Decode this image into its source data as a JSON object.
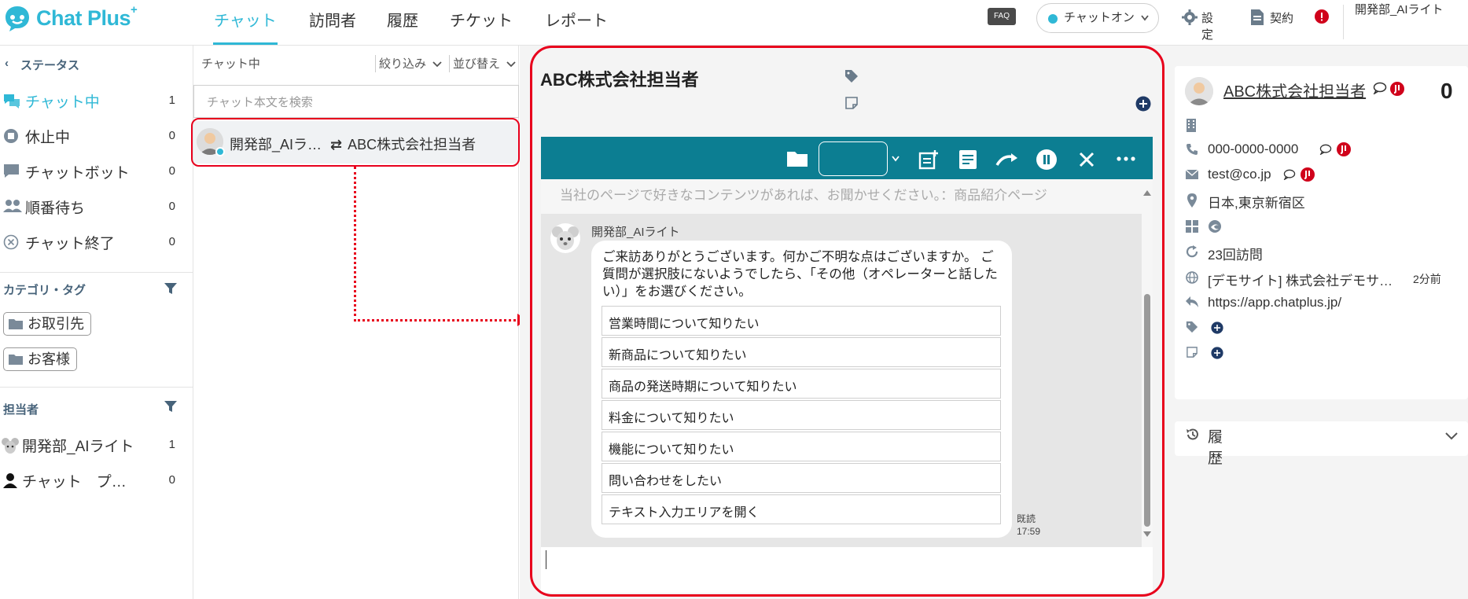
{
  "header": {
    "logo": "Chat Plus",
    "logo_sup": "+",
    "nav": [
      "チャット",
      "訪問者",
      "履歴",
      "チケット",
      "レポート"
    ],
    "faq": "FAQ",
    "chat_status": "チャットオン",
    "settings": "設定",
    "contract": "契約",
    "user": "開発部_AIライト"
  },
  "sidebar": {
    "status_head": "ステータス",
    "items": [
      {
        "label": "チャット中",
        "count": "1"
      },
      {
        "label": "休止中",
        "count": "0"
      },
      {
        "label": "チャットボット",
        "count": "0"
      },
      {
        "label": "順番待ち",
        "count": "0"
      },
      {
        "label": "チャット終了",
        "count": "0"
      }
    ],
    "category_head": "カテゴリ・タグ",
    "tags": [
      "お取引先",
      "お客様"
    ],
    "assignee_head": "担当者",
    "assignees": [
      {
        "label": "開発部_AIライト",
        "count": "1"
      },
      {
        "label": "チャット　プ…",
        "count": "0"
      }
    ]
  },
  "chatlist": {
    "head": "チャット中",
    "filter": "絞り込み",
    "sort": "並び替え",
    "search_placeholder": "チャット本文を検索",
    "row_left": "開発部_AIラ…",
    "row_arrow": "⇄",
    "row_right": "ABC株式会社担当者"
  },
  "conversation": {
    "title": "ABC株式会社担当者",
    "prev_message": "当社のページで好きなコンテンツがあれば、お聞かせください。：商品紹介ページ",
    "bot_name": "開発部_AIライト",
    "message": "ご来訪ありがとうございます。何かご不明な点はございますか。 ご質問が選択肢にないようでしたら、「その他（オペレーターと話したい）」をお選びください。",
    "options": [
      "営業時間について知りたい",
      "新商品について知りたい",
      "商品の発送時期について知りたい",
      "料金について知りたい",
      "機能について知りたい",
      "問い合わせをしたい",
      "テキスト入力エリアを開く"
    ],
    "read_label": "既読",
    "time": "17:59"
  },
  "visitor": {
    "name": "ABC株式会社担当者",
    "count": "0",
    "phone": "000-0000-0000",
    "email": "test@co.jp",
    "location": "日本,東京新宿区",
    "visits": "23回訪問",
    "page": "[デモサイト] 株式会社デモサ…",
    "page_ago": "2分前",
    "url": "https://app.chatplus.jp/",
    "history": "履歴"
  },
  "colors": {
    "accent": "#2fb8d6",
    "toolbar": "#0c7e92",
    "highlight": "#e8001c"
  }
}
